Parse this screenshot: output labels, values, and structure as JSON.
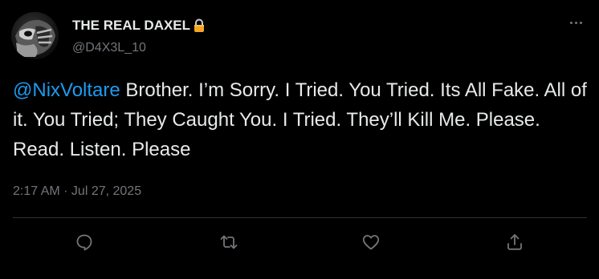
{
  "author": {
    "display_name": "THE REAL DAXEL",
    "verified_emoji": "🔒",
    "handle": "@D4X3L_10"
  },
  "tweet": {
    "mention": "@NixVoltare",
    "body": " Brother. I’m Sorry. I Tried. You Tried. Its All Fake. All of it. You Tried; They Caught You. I Tried. They’ll Kill Me. Please. Read. Listen. Please",
    "timestamp": "2:17 AM · Jul 27, 2025"
  },
  "actions": [
    {
      "name": "reply",
      "icon": "reply-icon"
    },
    {
      "name": "retweet",
      "icon": "retweet-icon"
    },
    {
      "name": "like",
      "icon": "heart-icon"
    },
    {
      "name": "share",
      "icon": "share-icon"
    }
  ],
  "colors": {
    "background": "#000000",
    "text_primary": "#e7e9ea",
    "text_secondary": "#71767b",
    "accent": "#1d9bf0",
    "divider": "#2f3336"
  }
}
